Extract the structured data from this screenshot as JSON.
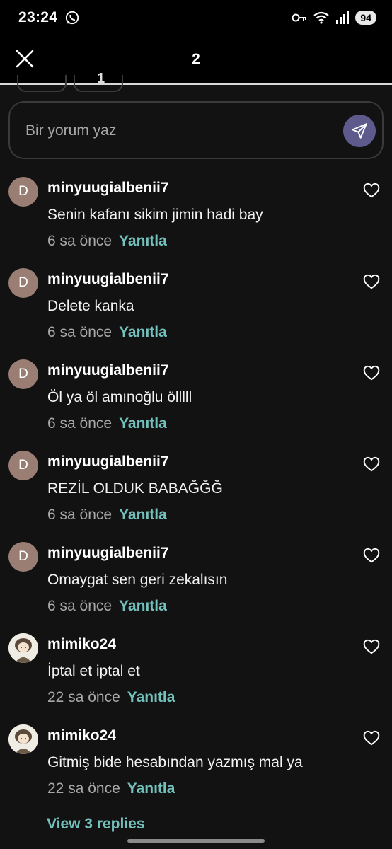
{
  "status_bar": {
    "time": "23:24",
    "battery": "94",
    "icons": [
      "whatsapp-icon",
      "key-icon",
      "wifi-icon",
      "signal-icon",
      "battery-icon"
    ]
  },
  "header": {
    "title": "2",
    "close_icon": "close-icon"
  },
  "filter_pill": {
    "label": "1"
  },
  "comment_input": {
    "placeholder": "Bir yorum yaz",
    "send_icon": "send-icon"
  },
  "comments": [
    {
      "avatar": "D",
      "username": "minyuugialbenii7",
      "text": "Senin kafanı sikim jimin hadi bay",
      "time": "6 sa önce",
      "reply": "Yanıtla"
    },
    {
      "avatar": "D",
      "username": "minyuugialbenii7",
      "text": "Delete kanka",
      "time": "6 sa önce",
      "reply": "Yanıtla"
    },
    {
      "avatar": "D",
      "username": "minyuugialbenii7",
      "text": "Öl ya öl amınoğlu ölllll",
      "time": "6 sa önce",
      "reply": "Yanıtla"
    },
    {
      "avatar": "D",
      "username": "minyuugialbenii7",
      "text": "REZİL OLDUK BABAĞĞĞ",
      "time": "6 sa önce",
      "reply": "Yanıtla"
    },
    {
      "avatar": "D",
      "username": "minyuugialbenii7",
      "text": "Omaygat sen geri zekalısın",
      "time": "6 sa önce",
      "reply": "Yanıtla"
    },
    {
      "avatar": "",
      "username": "mimiko24",
      "text": "İptal et iptal et",
      "time": "22 sa önce",
      "reply": "Yanıtla"
    },
    {
      "avatar": "",
      "username": "mimiko24",
      "text": "Gitmiş bide hesabından yazmış mal ya",
      "time": "22 sa önce",
      "reply": "Yanıtla"
    }
  ],
  "view_replies": "View 3 replies",
  "colors": {
    "background": "#121212",
    "accent_teal": "#73c1bd",
    "send_button": "#5e5a8c",
    "avatar_letter_bg": "#9a7e73"
  }
}
